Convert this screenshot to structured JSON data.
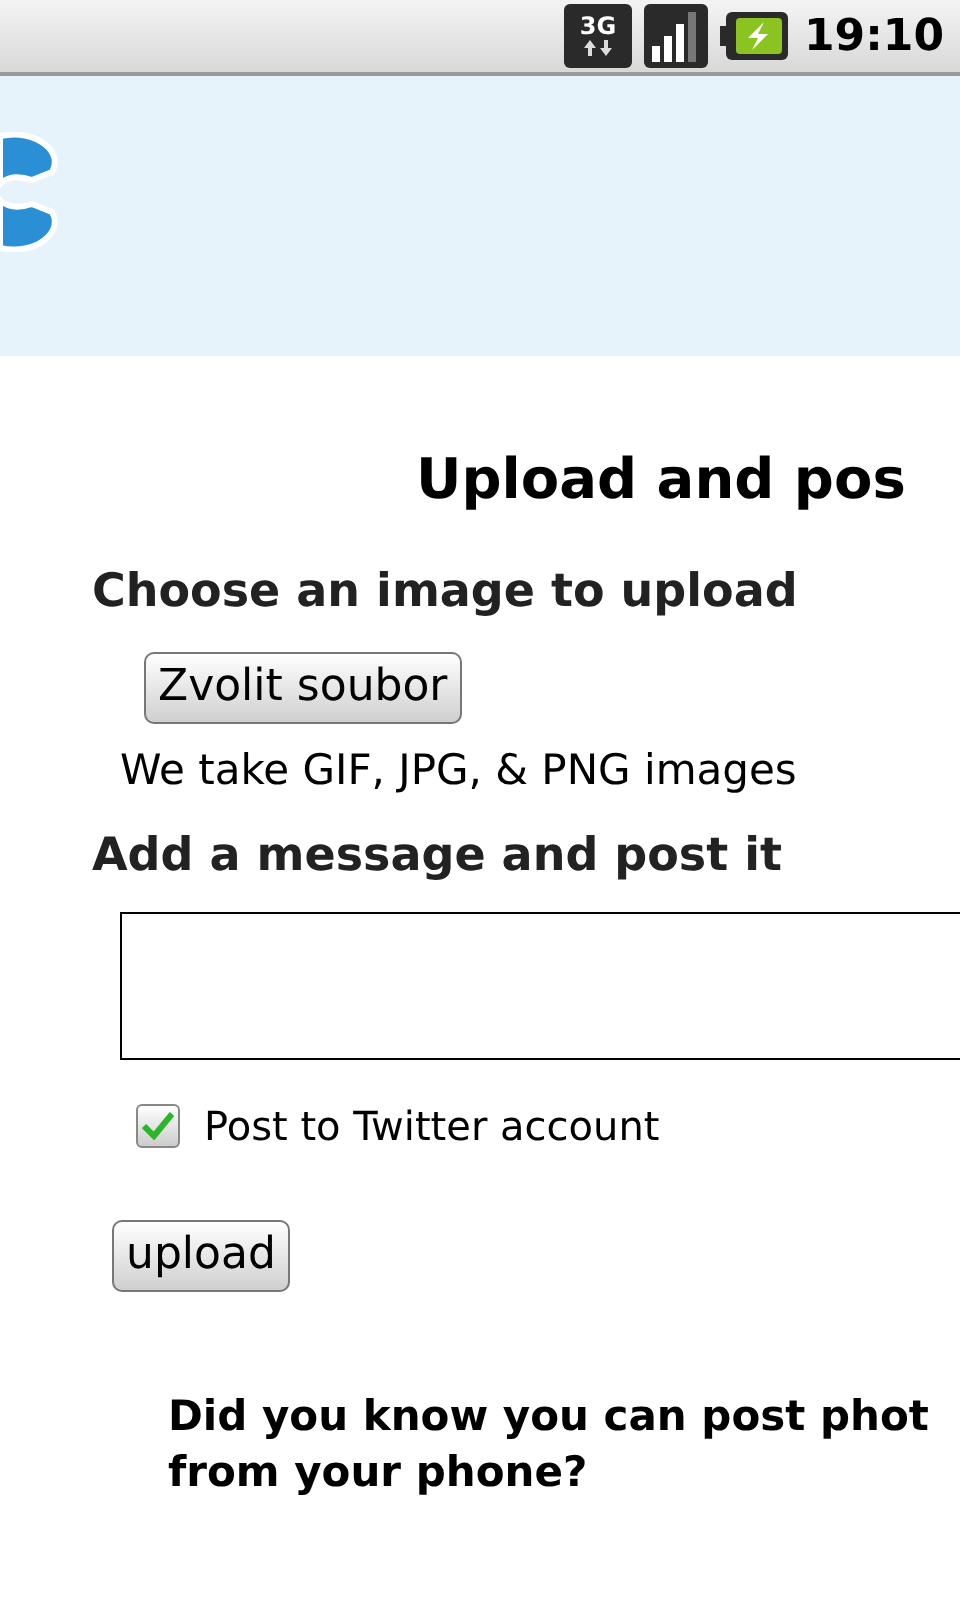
{
  "status_bar": {
    "network": "3G",
    "time": "19:10"
  },
  "page": {
    "title": "Upload and pos",
    "image_section": {
      "heading": "Choose an image to upload",
      "file_button": "Zvolit soubor",
      "hint": "We take GIF, JPG, & PNG images"
    },
    "message_section": {
      "heading": "Add a message and post it",
      "twitter_option": {
        "label": "Post to Twitter account",
        "checked": true
      },
      "submit_button": "upload"
    },
    "promo": "Did you know you can post phot\nfrom your phone?"
  }
}
